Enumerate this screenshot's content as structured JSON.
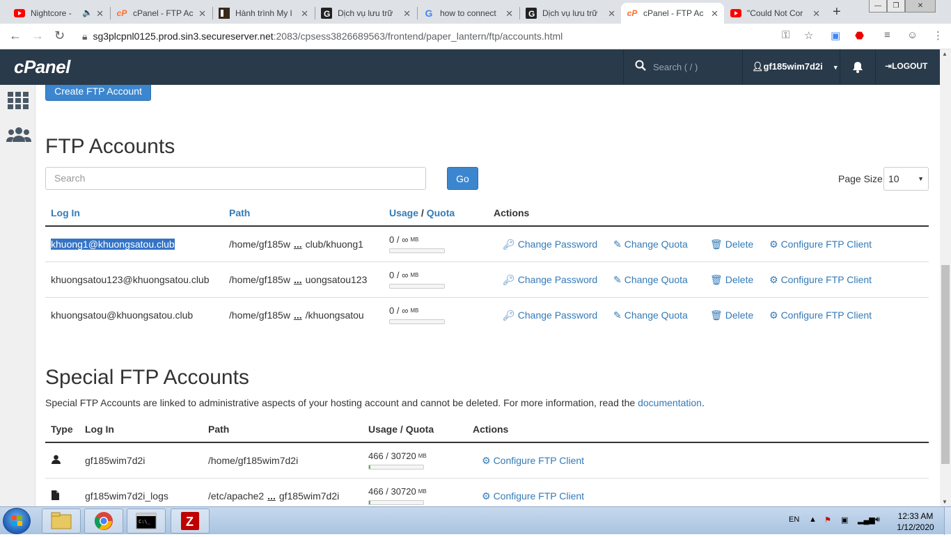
{
  "browser": {
    "tabs": [
      {
        "title": "Nightcore -",
        "icon": "youtube-icon",
        "active": false
      },
      {
        "title": "cPanel - FTP Ac",
        "icon": "cpanel-icon",
        "active": false
      },
      {
        "title": "Hành trình My l",
        "icon": "page-icon",
        "active": false
      },
      {
        "title": "Dịch vụ lưu trữ",
        "icon": "g-icon",
        "active": false
      },
      {
        "title": "how to connect",
        "icon": "google-icon",
        "active": false
      },
      {
        "title": "Dịch vụ lưu trữ",
        "icon": "g-icon",
        "active": false
      },
      {
        "title": "cPanel - FTP Ac",
        "icon": "cpanel-icon",
        "active": true
      },
      {
        "title": "\"Could Not Cor",
        "icon": "youtube-icon",
        "active": false
      }
    ],
    "url_host": "sg3plcpnl0125.prod.sin3.secureserver.net",
    "url_path": ":2083/cpsess3826689563/frontend/paper_lantern/ftp/accounts.html"
  },
  "header": {
    "logo": "cPanel",
    "search_placeholder": "Search ( / )",
    "username": "gf185wim7d2i",
    "logout": "LOGOUT"
  },
  "main": {
    "create_button": "Create FTP Account",
    "ftp_title": "FTP Accounts",
    "search_placeholder": "Search",
    "go_button": "Go",
    "page_size_label": "Page Size",
    "page_size_value": "10",
    "columns": {
      "login": "Log In",
      "path": "Path",
      "usage": "Usage",
      "slash": "/",
      "quota": "Quota",
      "actions": "Actions"
    },
    "accounts": [
      {
        "login": "khuong1@khuongsatou.club",
        "path_start": "/home/gf185w",
        "path_dots": "...",
        "path_end": "club/khuong1",
        "usage": "0 / ∞",
        "unit": "MB",
        "usage_fraction": 0
      },
      {
        "login": "khuongsatou123@khuongsatou.club",
        "path_start": "/home/gf185w",
        "path_dots": "...",
        "path_end": "uongsatou123",
        "usage": "0 / ∞",
        "unit": "MB",
        "usage_fraction": 0
      },
      {
        "login": "khuongsatou@khuongsatou.club",
        "path_start": "/home/gf185w",
        "path_dots": "...",
        "path_end": "/khuongsatou",
        "usage": "0 / ∞",
        "unit": "MB",
        "usage_fraction": 0
      }
    ],
    "actions": {
      "change_password": "Change Password",
      "change_quota": "Change Quota",
      "delete": "Delete",
      "configure": "Configure FTP Client"
    },
    "special_title": "Special FTP Accounts",
    "special_desc": "Special FTP Accounts are linked to administrative aspects of your hosting account and cannot be deleted. For more information, read the",
    "special_desc_link": "documentation",
    "special_desc_end": ".",
    "special_columns": {
      "type": "Type",
      "login": "Log In",
      "path": "Path",
      "usage": "Usage / Quota",
      "actions": "Actions"
    },
    "special_accounts": [
      {
        "type_icon": "user-icon",
        "login": "gf185wim7d2i",
        "path": "/home/gf185wim7d2i",
        "usage": "466 / 30720",
        "unit": "MB",
        "usage_fraction": 0.015
      },
      {
        "type_icon": "file-icon",
        "login": "gf185wim7d2i_logs",
        "path_start": "/etc/apache2",
        "path_dots": "...",
        "path_end": "gf185wim7d2i",
        "usage": "466 / 30720",
        "unit": "MB",
        "usage_fraction": 0.015
      }
    ]
  },
  "taskbar": {
    "lang": "EN",
    "time": "12:33 AM",
    "date": "1/12/2020"
  },
  "colors": {
    "cpanel_header": "#293a4a",
    "link": "#337ab7",
    "primary_button": "#3b86cf",
    "selection": "#3373c6"
  }
}
